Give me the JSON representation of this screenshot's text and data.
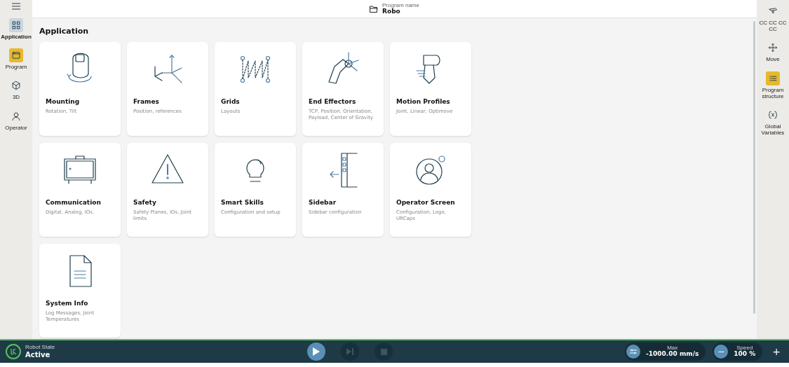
{
  "header": {
    "caption": "Program name",
    "name": "Robo"
  },
  "left_nav": [
    {
      "label": "Application",
      "selected": true,
      "active": false
    },
    {
      "label": "Program",
      "selected": false,
      "active": true
    },
    {
      "label": "3D",
      "selected": false,
      "active": false
    },
    {
      "label": "Operator",
      "selected": false,
      "active": false
    }
  ],
  "section_title": "Application",
  "cards": [
    {
      "title": "Mounting",
      "subtitle": "Rotation, Tilt"
    },
    {
      "title": "Frames",
      "subtitle": "Position, references"
    },
    {
      "title": "Grids",
      "subtitle": "Layouts"
    },
    {
      "title": "End Effectors",
      "subtitle": "TCP, Position, Orientation, Payload, Center of Gravity"
    },
    {
      "title": "Motion Profiles",
      "subtitle": "Joint, Linear, Optimove"
    },
    {
      "title": "Communication",
      "subtitle": "Digital, Analog, IOs."
    },
    {
      "title": "Safety",
      "subtitle": "Safety Planes, IOs, Joint limits"
    },
    {
      "title": "Smart Skills",
      "subtitle": "Configuration and setup"
    },
    {
      "title": "Sidebar",
      "subtitle": "Sidebar configuration"
    },
    {
      "title": "Operator Screen",
      "subtitle": "Configuration, Logo, URCaps"
    },
    {
      "title": "System Info",
      "subtitle": "Log Messages, Joint Temperatures"
    }
  ],
  "right_nav": [
    {
      "label": "CC CC CC CC",
      "active": false
    },
    {
      "label": "Move",
      "active": false
    },
    {
      "label": "Program structure",
      "active": true
    },
    {
      "label": "Global Variables",
      "active": false
    }
  ],
  "status_bar": {
    "state_caption": "Robot State",
    "state": "Active",
    "controls": [
      {
        "kind": "play",
        "disabled": false
      },
      {
        "kind": "step",
        "disabled": true
      },
      {
        "kind": "stop",
        "disabled": true
      }
    ],
    "max_caption": "Max",
    "max_value": "-1000.00 mm/s",
    "speed_caption": "Speed",
    "speed_value": "100 %",
    "minus": "−",
    "plus": "+"
  }
}
